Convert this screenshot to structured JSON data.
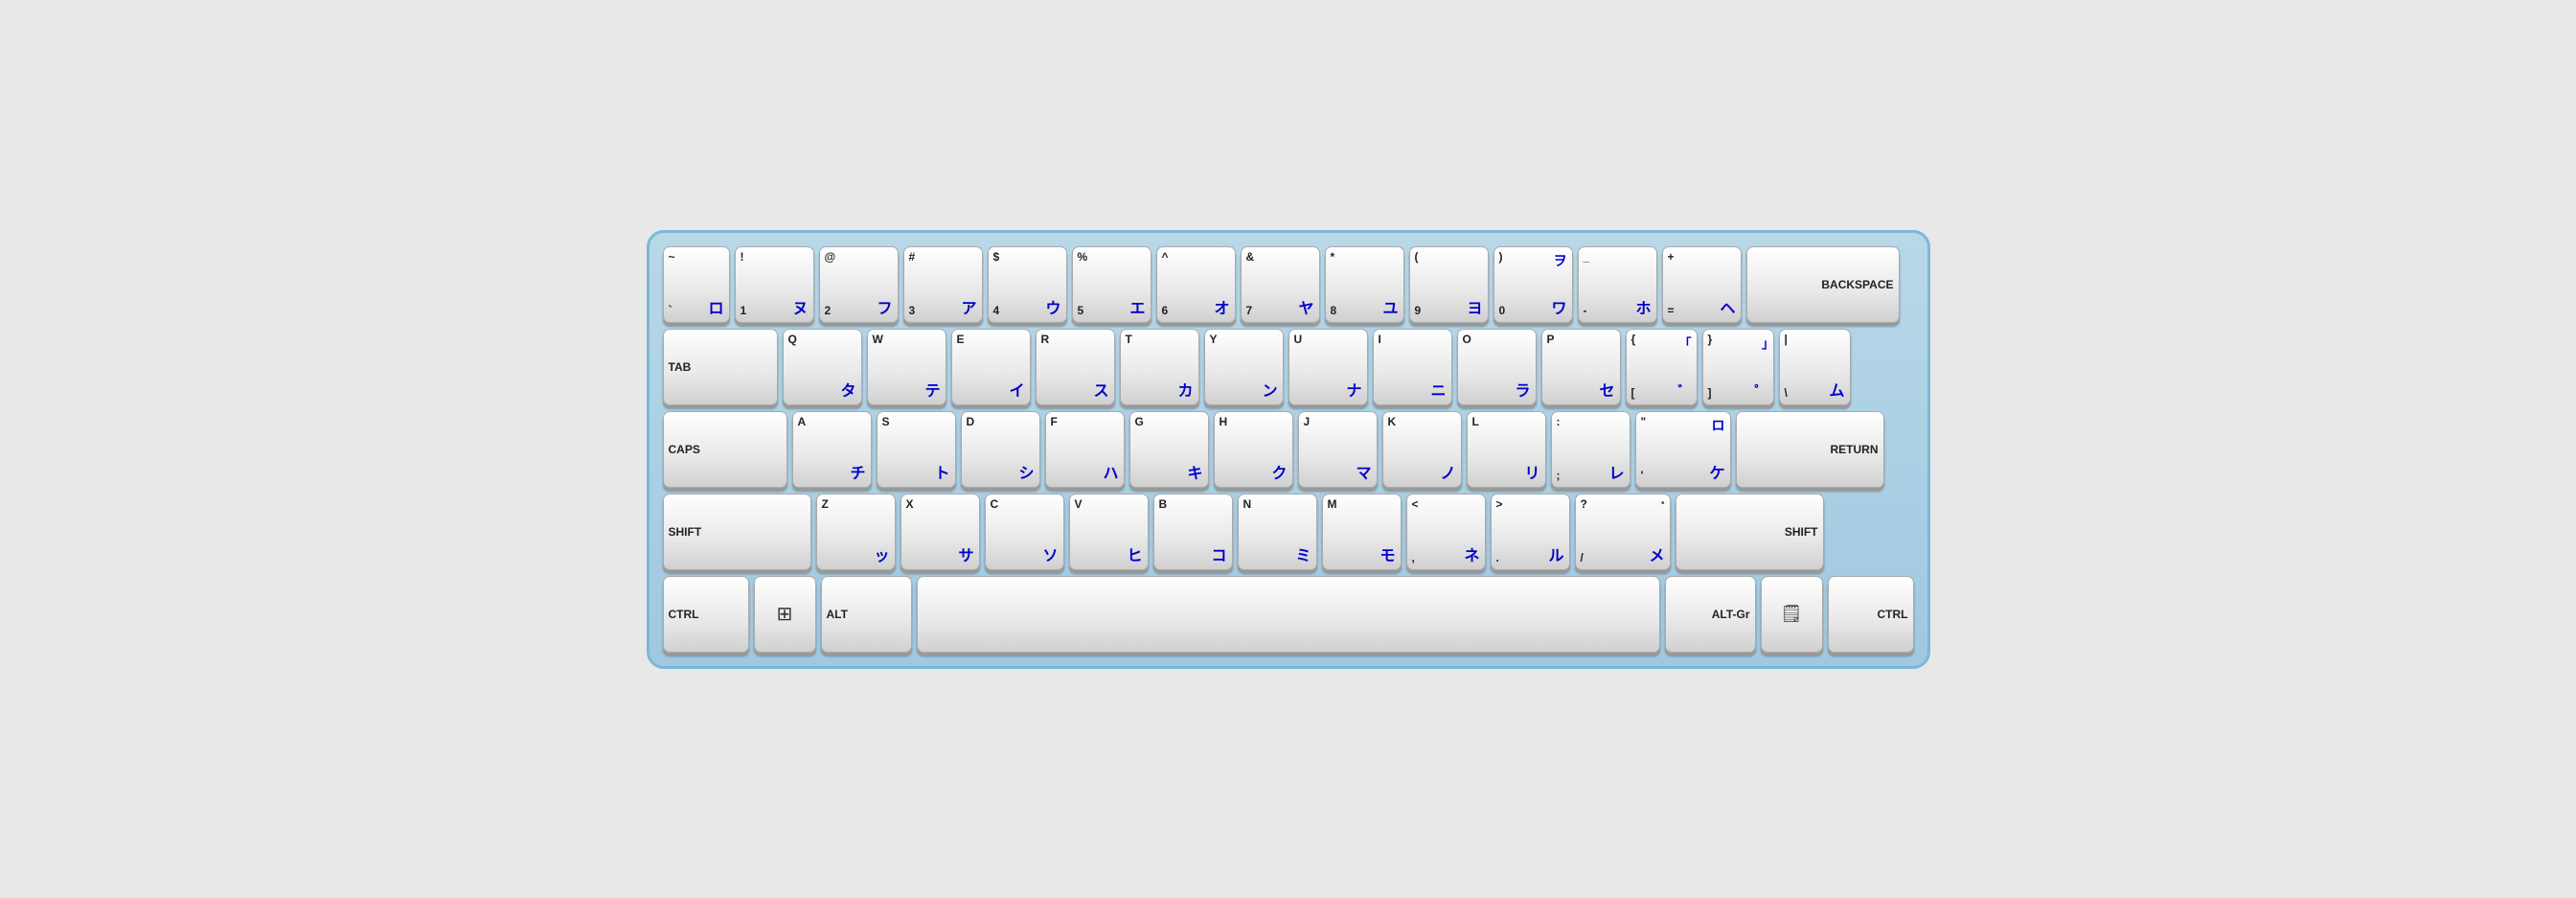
{
  "keyboard": {
    "rows": [
      {
        "id": "row-number",
        "keys": [
          {
            "id": "backtick",
            "label": "~",
            "label2": "`",
            "kana": "ロ",
            "special": false,
            "wide": "backtick"
          },
          {
            "id": "1",
            "label": "!",
            "label2": "1",
            "kana": "ヌ",
            "special": false
          },
          {
            "id": "2",
            "label": "@",
            "label2": "2",
            "kana": "フ",
            "special": false
          },
          {
            "id": "3",
            "label": "#",
            "label2": "3",
            "kana": "ア",
            "special": false
          },
          {
            "id": "4",
            "label": "$",
            "label2": "4",
            "kana": "ウ",
            "special": false
          },
          {
            "id": "5",
            "label": "%",
            "label2": "5",
            "kana": "エ",
            "special": false
          },
          {
            "id": "6",
            "label": "^",
            "label2": "6",
            "kana": "オ",
            "special": false
          },
          {
            "id": "7",
            "label": "&",
            "label2": "7",
            "kana": "ヤ",
            "special": false
          },
          {
            "id": "8",
            "label": "*",
            "label2": "8",
            "kana": "ユ",
            "special": false
          },
          {
            "id": "9",
            "label": "(",
            "label2": "9",
            "kana": "ヨ",
            "special": false
          },
          {
            "id": "0",
            "label": ")",
            "label2": "0",
            "kana": "ワ",
            "special": false
          },
          {
            "id": "minus",
            "label": "_",
            "label2": "-",
            "kana": "ホ",
            "special": false
          },
          {
            "id": "equals",
            "label": "+",
            "label2": "=",
            "kana": "ヘ",
            "special": false
          },
          {
            "id": "backspace",
            "label": "BACKSPACE",
            "kana": "",
            "special": true,
            "wide": "backspace"
          }
        ]
      },
      {
        "id": "row-qwerty",
        "keys": [
          {
            "id": "tab",
            "label": "TAB",
            "kana": "",
            "special": true,
            "wide": "tab"
          },
          {
            "id": "q",
            "label": "Q",
            "kana": "タ",
            "special": false
          },
          {
            "id": "w",
            "label": "W",
            "kana": "テ",
            "special": false
          },
          {
            "id": "e",
            "label": "E",
            "kana": "イ",
            "special": false
          },
          {
            "id": "r",
            "label": "R",
            "kana": "ス",
            "special": false
          },
          {
            "id": "t",
            "label": "T",
            "kana": "カ",
            "special": false
          },
          {
            "id": "y",
            "label": "Y",
            "kana": "ン",
            "special": false
          },
          {
            "id": "u",
            "label": "U",
            "kana": "ナ",
            "special": false
          },
          {
            "id": "i",
            "label": "I",
            "kana": "ニ",
            "special": false
          },
          {
            "id": "o",
            "label": "O",
            "kana": "ラ",
            "special": false
          },
          {
            "id": "p",
            "label": "P",
            "kana": "セ",
            "special": false
          },
          {
            "id": "open-bracket",
            "label": "{",
            "label2": "[",
            "kana": "゛",
            "special": false,
            "wide": "p-bracket"
          },
          {
            "id": "close-bracket",
            "label": "}",
            "label2": "]",
            "kana": "゜",
            "special": false,
            "wide": "close-bracket"
          },
          {
            "id": "backslash",
            "label": "|",
            "label2": "\\",
            "kana": "ム",
            "special": false,
            "wide": "backslash"
          }
        ]
      },
      {
        "id": "row-asdf",
        "keys": [
          {
            "id": "caps",
            "label": "CAPS",
            "kana": "",
            "special": true,
            "wide": "caps"
          },
          {
            "id": "a",
            "label": "A",
            "kana": "チ",
            "special": false
          },
          {
            "id": "s",
            "label": "S",
            "kana": "ト",
            "special": false
          },
          {
            "id": "d",
            "label": "D",
            "kana": "シ",
            "special": false
          },
          {
            "id": "f",
            "label": "F",
            "kana": "ハ",
            "special": false
          },
          {
            "id": "g",
            "label": "G",
            "kana": "キ",
            "special": false
          },
          {
            "id": "h",
            "label": "H",
            "kana": "ク",
            "special": false
          },
          {
            "id": "j",
            "label": "J",
            "kana": "マ",
            "special": false
          },
          {
            "id": "k",
            "label": "K",
            "kana": "ノ",
            "special": false
          },
          {
            "id": "l",
            "label": "L",
            "kana": "リ",
            "special": false
          },
          {
            "id": "semicolon",
            "label": ":",
            "label2": ";",
            "kana": "レ",
            "special": false,
            "wide": "semicolon"
          },
          {
            "id": "quote",
            "label": "\"",
            "label2": "'",
            "kana": "ケ",
            "special": false,
            "wide": "quote"
          },
          {
            "id": "return",
            "label": "RETURN",
            "kana": "",
            "special": true,
            "wide": "return"
          }
        ]
      },
      {
        "id": "row-zxcv",
        "keys": [
          {
            "id": "shift-l",
            "label": "SHIFT",
            "kana": "",
            "special": true,
            "wide": "shift-l"
          },
          {
            "id": "z",
            "label": "Z",
            "kana": "ッ",
            "special": false
          },
          {
            "id": "x",
            "label": "X",
            "kana": "サ",
            "special": false
          },
          {
            "id": "c",
            "label": "C",
            "kana": "ソ",
            "special": false
          },
          {
            "id": "v",
            "label": "V",
            "kana": "ヒ",
            "special": false
          },
          {
            "id": "b",
            "label": "B",
            "kana": "コ",
            "special": false
          },
          {
            "id": "n",
            "label": "N",
            "kana": "ミ",
            "special": false
          },
          {
            "id": "m",
            "label": "M",
            "kana": "モ",
            "special": false
          },
          {
            "id": "comma",
            "label": "<",
            "label2": ",",
            "kana": "ネ",
            "special": false,
            "wide": "comma"
          },
          {
            "id": "period",
            "label": ">",
            "label2": ".",
            "kana": "ル",
            "special": false,
            "wide": "period"
          },
          {
            "id": "slash",
            "label": "?",
            "label2": "/",
            "kana": "メ",
            "special": false,
            "wide": "slash"
          },
          {
            "id": "shift-r",
            "label": "SHIFT",
            "kana": "",
            "special": true,
            "wide": "shift-r"
          }
        ]
      },
      {
        "id": "row-bottom",
        "keys": [
          {
            "id": "ctrl-l",
            "label": "CTRL",
            "kana": "",
            "special": true,
            "wide": "ctrl"
          },
          {
            "id": "win",
            "label": "WIN",
            "kana": "",
            "special": true,
            "wide": "win"
          },
          {
            "id": "alt",
            "label": "ALT",
            "kana": "",
            "special": true,
            "wide": "alt"
          },
          {
            "id": "space",
            "label": "",
            "kana": "",
            "special": true,
            "wide": "space"
          },
          {
            "id": "altgr",
            "label": "ALT-Gr",
            "kana": "",
            "special": true,
            "wide": "altgr"
          },
          {
            "id": "menu",
            "label": "MENU",
            "kana": "",
            "special": true,
            "wide": "menu"
          },
          {
            "id": "ctrl-r",
            "label": "CTRL",
            "kana": "",
            "special": true,
            "wide": "ctrl"
          }
        ]
      }
    ]
  }
}
